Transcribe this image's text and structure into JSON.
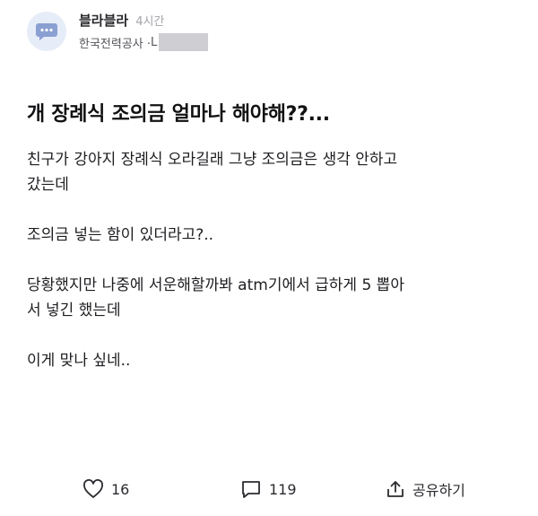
{
  "author": {
    "name": "블라블라",
    "time": "4시간",
    "company": "한국전력공사 · ",
    "job_initial": "L"
  },
  "post": {
    "title": "개 장례식 조의금 얼마나 해야해??...",
    "paragraphs": [
      [
        "친구가 강아지 장례식 오라길래 그냥 조의금은 생각 안하고",
        "갔는데"
      ],
      [
        "조의금 넣는 함이 있더라고?.."
      ],
      [
        "당황했지만 나중에 서운해할까봐 atm기에서 급하게 5 뽑아",
        "서 넣긴 했는데"
      ],
      [
        "이게 맞나 싶네.."
      ]
    ]
  },
  "actions": {
    "like_count": "16",
    "comment_count": "119",
    "share_label": "공유하기"
  },
  "icons": {
    "avatar": "chat-bubble-icon",
    "like": "heart-outline-icon",
    "comment": "comment-bubble-icon",
    "share": "share-upload-icon"
  },
  "colors": {
    "avatar_bg": "#e6ecf8",
    "avatar_icon": "#8aa0d2",
    "muted_text": "#a4a4aa",
    "redaction": "#cfcfd3"
  }
}
